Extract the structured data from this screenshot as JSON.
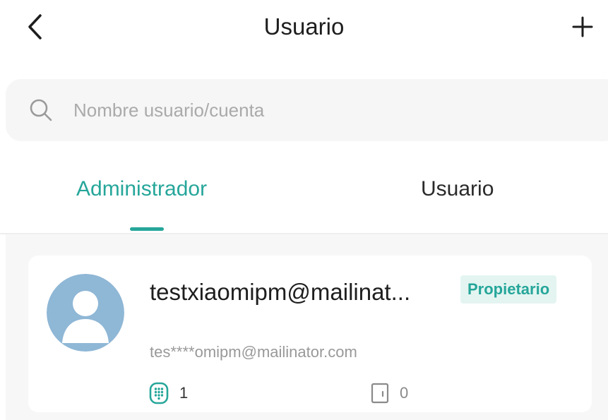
{
  "header": {
    "title": "Usuario",
    "back_icon": "chevron-left-icon",
    "add_icon": "plus-icon"
  },
  "search": {
    "placeholder": "Nombre usuario/cuenta",
    "value": "",
    "icon": "search-icon"
  },
  "tabs": [
    {
      "label": "Administrador",
      "active": true
    },
    {
      "label": "Usuario",
      "active": false
    }
  ],
  "users": [
    {
      "name": "testxiaomipm@mailinat...",
      "account": "tes****omipm@mailinator.com",
      "role": "Propietario",
      "keypad_count": "1",
      "door_count": "0",
      "keypad_icon": "keypad-icon",
      "door_icon": "door-icon",
      "avatar_icon": "default-avatar-icon"
    }
  ],
  "colors": {
    "accent": "#26a69a",
    "badge_bg": "#e4f5f1",
    "avatar_bg": "#8fb7d6",
    "content_bg": "#f7f7f7",
    "search_bg": "#f6f6f6"
  }
}
